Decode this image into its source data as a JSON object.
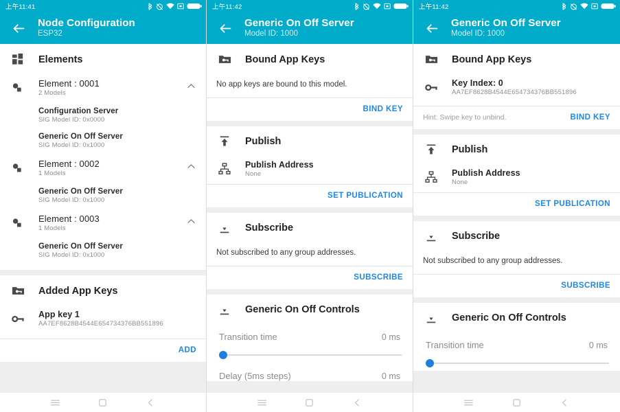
{
  "theme": {
    "appbar_color": "#00ACC9",
    "link_color": "#1e88e5",
    "slider_thumb_color": "#1f7fe0",
    "page_bg": "#eeeeee"
  },
  "screens": [
    {
      "status": {
        "clock": "上午11:41"
      },
      "appbar": {
        "back": "back-arrow",
        "title": "Node Configuration",
        "subtitle": "ESP32"
      },
      "elements_section": {
        "icon": "dashboard-icon",
        "title": "Elements",
        "elements": [
          {
            "icon": "device-hub-icon",
            "name": "Element : 0001",
            "count": "2 Models",
            "expanded": true,
            "models": [
              {
                "name": "Configuration Server",
                "id": "SIG Model ID: 0x0000"
              },
              {
                "name": "Generic On Off Server",
                "id": "SIG Model ID: 0x1000"
              }
            ]
          },
          {
            "icon": "device-hub-icon",
            "name": "Element : 0002",
            "count": "1 Models",
            "expanded": true,
            "models": [
              {
                "name": "Generic On Off Server",
                "id": "SIG Model ID: 0x1000"
              }
            ]
          },
          {
            "icon": "device-hub-icon",
            "name": "Element : 0003",
            "count": "1 Models",
            "expanded": true,
            "models": [
              {
                "name": "Generic On Off Server",
                "id": "SIG Model ID: 0x1000"
              }
            ]
          }
        ]
      },
      "appkeys_section": {
        "icon": "folder-key-icon",
        "title": "Added App Keys",
        "key": {
          "icon": "key-icon",
          "name": "App key 1",
          "value": "AA7EF8628B4544E654734376BB551896"
        },
        "action": "ADD"
      }
    },
    {
      "status": {
        "clock": "上午11:42"
      },
      "appbar": {
        "back": "back-arrow",
        "title": "Generic On Off Server",
        "subtitle": "Model ID: 1000"
      },
      "bound_keys": {
        "icon": "folder-key-icon",
        "title": "Bound App Keys",
        "empty_text": "No app keys are bound to this model.",
        "hint": "",
        "action": "BIND KEY"
      },
      "publish": {
        "icon": "publish-icon",
        "title": "Publish",
        "row": {
          "icon": "account-tree-icon",
          "label": "Publish Address",
          "value": "None"
        },
        "action": "SET PUBLICATION"
      },
      "subscribe": {
        "icon": "subscribe-icon",
        "title": "Subscribe",
        "empty_text": "Not subscribed to any group addresses.",
        "action": "SUBSCRIBE"
      },
      "controls": {
        "icon": "subscribe-icon",
        "title": "Generic On Off Controls",
        "sliders": [
          {
            "label": "Transition time",
            "value": "0 ms",
            "percent": 0
          },
          {
            "label": "Delay (5ms steps)",
            "value": "0 ms",
            "percent": 0
          }
        ]
      }
    },
    {
      "status": {
        "clock": "上午11:42"
      },
      "appbar": {
        "back": "back-arrow",
        "title": "Generic On Off Server",
        "subtitle": "Model ID: 1000"
      },
      "bound_keys": {
        "icon": "folder-key-icon",
        "title": "Bound App Keys",
        "key": {
          "icon": "key-icon",
          "name": "Key Index: 0",
          "value": "AA7EF8628B4544E654734376BB551896"
        },
        "hint": "Hint: Swipe key to unbind.",
        "action": "BIND KEY"
      },
      "publish": {
        "icon": "publish-icon",
        "title": "Publish",
        "row": {
          "icon": "account-tree-icon",
          "label": "Publish Address",
          "value": "None"
        },
        "action": "SET PUBLICATION"
      },
      "subscribe": {
        "icon": "subscribe-icon",
        "title": "Subscribe",
        "empty_text": "Not subscribed to any group addresses.",
        "action": "SUBSCRIBE"
      },
      "controls": {
        "icon": "subscribe-icon",
        "title": "Generic On Off Controls",
        "sliders": [
          {
            "label": "Transition time",
            "value": "0 ms",
            "percent": 0
          }
        ]
      }
    }
  ],
  "navbar": {
    "menu": "menu-icon",
    "home": "home-square-icon",
    "back": "back-chevron-icon"
  }
}
